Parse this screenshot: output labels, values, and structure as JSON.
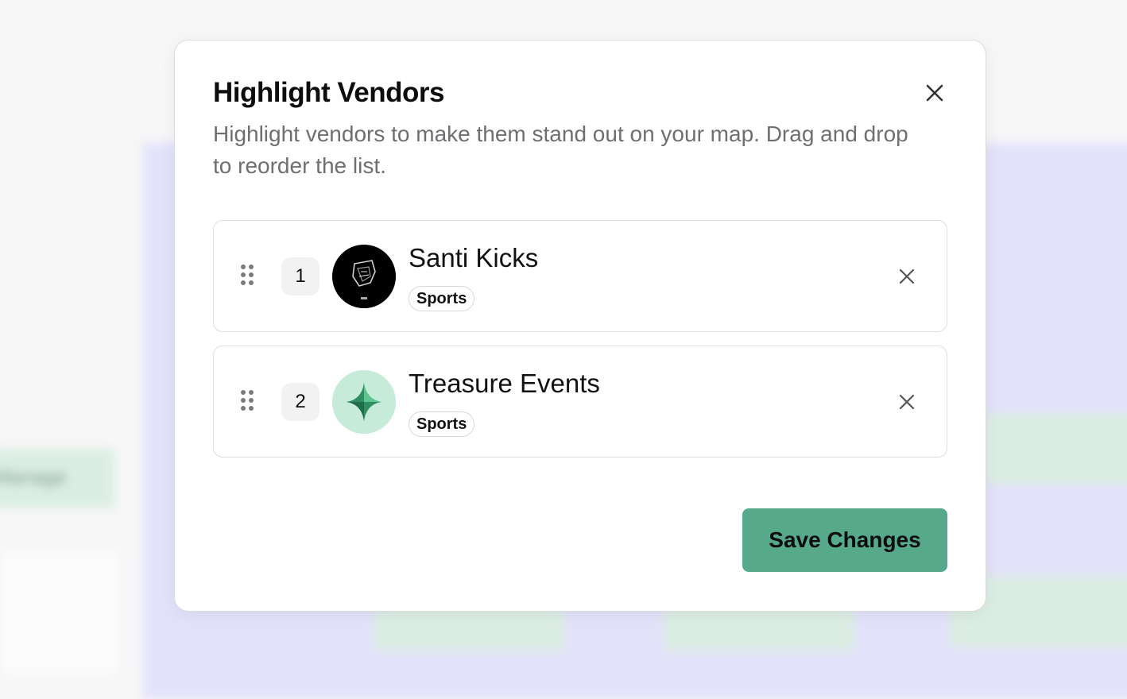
{
  "modal": {
    "title": "Highlight Vendors",
    "description": "Highlight vendors to make them stand out on your map. Drag and drop to reorder the list.",
    "close_icon": "close-icon",
    "save_label": "Save Changes"
  },
  "vendors": [
    {
      "rank": "1",
      "name": "Santi Kicks",
      "category": "Sports",
      "avatar": "santi-kicks-logo"
    },
    {
      "rank": "2",
      "name": "Treasure Events",
      "category": "Sports",
      "avatar": "sparkle-icon"
    }
  ],
  "background": {
    "blurred_text": "Manage"
  },
  "colors": {
    "accent": "#56a98a",
    "background_panel": "#e3e2fb",
    "muted_text": "#6f6f73"
  }
}
